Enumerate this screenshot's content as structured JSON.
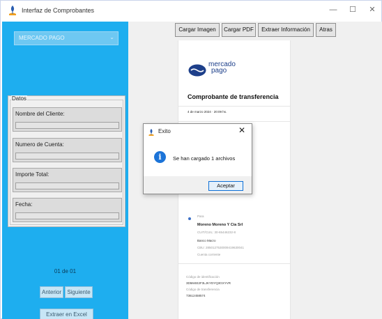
{
  "window": {
    "title": "Interfaz de Comprobantes",
    "controls": {
      "minimize": "—",
      "maximize": "☐",
      "close": "✕"
    }
  },
  "sidebar": {
    "combo_value": "MERCADO PAGO",
    "combo_arrow": "⌄",
    "group_title": "Datos",
    "fields": [
      {
        "label": "Nombre del Cliente:",
        "value": ""
      },
      {
        "label": "Numero de Cuenta:",
        "value": ""
      },
      {
        "label": "Importe Total:",
        "value": ""
      },
      {
        "label": "Fecha:",
        "value": ""
      }
    ],
    "counter": "01 de 01",
    "prev_label": "Anterior",
    "next_label": "Siguiente",
    "excel_label": "Extraer en Excel"
  },
  "toolbar": {
    "load_image": "Cargar Imagen",
    "load_pdf": "Cargar PDF",
    "extract_info": "Extraer Información",
    "back": "Atras"
  },
  "document": {
    "logo_line1": "mercado",
    "logo_line2": "pago",
    "title": "Comprobante de transferencia",
    "date": "4 de marzo 2024 · 20:09 hs.",
    "para_label": "Para",
    "recipient": "Moreno Moreno Y Cia Srl",
    "cuit": "CUIT/CUIL: 30-65446232-8",
    "bank": "Banco Macro",
    "cbu": "CBU: 2850127530009419630041",
    "account_type": "Cuenta corriente",
    "id_label": "Código de identificación",
    "id_value": "3D5M4E2F3LJKYDYQ3GXYVR",
    "transfer_label": "Código de transferencia",
    "transfer_value": "73612458574"
  },
  "dialog": {
    "title": "Exito",
    "close": "✕",
    "info_glyph": "i",
    "message": "Se han cargado 1 archivos",
    "ok_label": "Aceptar"
  }
}
